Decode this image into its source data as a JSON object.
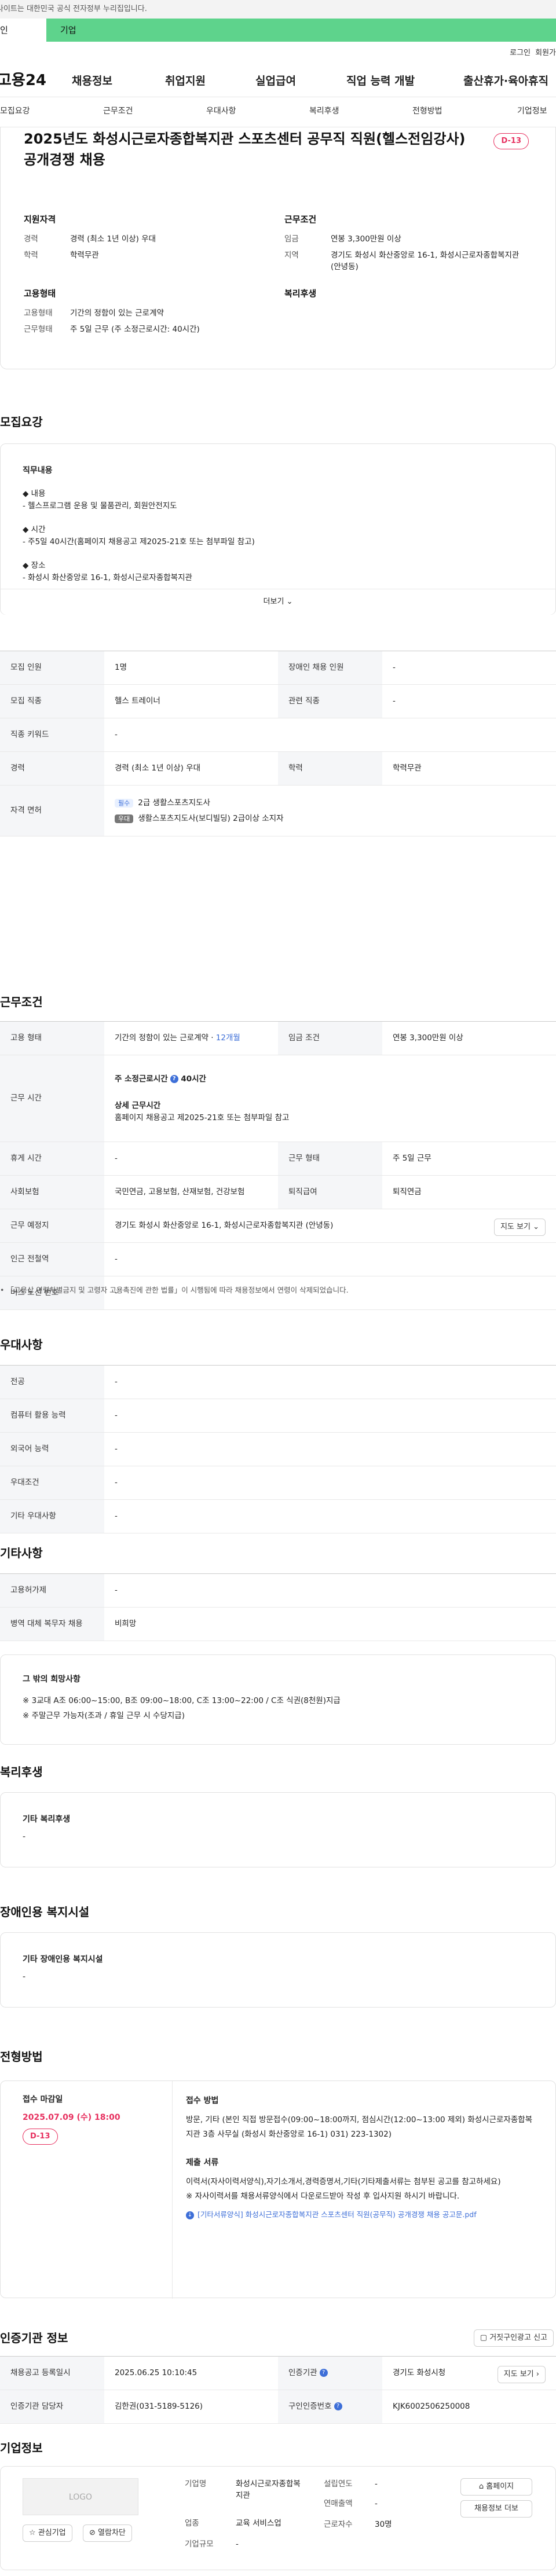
{
  "topbar": {
    "notice": "사이트는 대한민국 공식 전자정부 누리집입니다."
  },
  "usertabs": {
    "individual": "인",
    "enterprise": "기업"
  },
  "utility": {
    "login": "로그인",
    "join": "회원가"
  },
  "gnb": {
    "logo": "고용24",
    "menu": [
      "채용정보",
      "취업지원",
      "실업급여",
      "직업 능력 개발",
      "출산휴가·육아휴직"
    ]
  },
  "subnav": [
    "모집요강",
    "근무조건",
    "우대사항",
    "복리후생",
    "전형방법",
    "기업정보"
  ],
  "header": {
    "title": "2025년도 화성시근로자종합복지관 스포츠센터 공무직 직원(헬스전임강사) 공개경쟁 채용",
    "dday": "D-13"
  },
  "summary": {
    "qualification": {
      "title": "지원자격",
      "rows": [
        {
          "k": "경력",
          "v": "경력 (최소 1년 이상) 우대"
        },
        {
          "k": "학력",
          "v": "학력무관"
        }
      ]
    },
    "conditions": {
      "title": "근무조건",
      "rows": [
        {
          "k": "임금",
          "v": "연봉 3,300만원 이상"
        },
        {
          "k": "지역",
          "v": "경기도 화성시 화산중앙로 16-1, 화성시근로자종합복지관 (안녕동)"
        }
      ]
    },
    "employment": {
      "title": "고용형태",
      "rows": [
        {
          "k": "고용형태",
          "v": "기간의 정함이 있는 근로계약"
        },
        {
          "k": "근무형태",
          "v": "주 5일 근무 (주 소정근로시간: 40시간)"
        }
      ]
    },
    "welfare": {
      "title": "복리후생"
    }
  },
  "recruit": {
    "title": "모집요강",
    "duty_heading": "직무내용",
    "lines": [
      "◆ 내용",
      "- 헬스프로그램 운용 및 물품관리, 회원안전지도",
      "◆ 시간",
      "- 주5일 40시간(홈페이지 채용공고 제2025-21호 또는 첨부파일 참고)",
      "◆ 장소",
      "- 화성시 화산중앙로 16-1, 화성시근로자종합복지관"
    ],
    "more": "더보기",
    "table": {
      "headcount_label": "모집 인원",
      "headcount": "1명",
      "disabled_label": "장애인 채용 인원",
      "disabled": "-",
      "job_label": "모집 직종",
      "job": "헬스 트레이너",
      "related_label": "관련 직종",
      "related": "-",
      "keyword_label": "직종 키워드",
      "keyword": "-",
      "career_label": "경력",
      "career": "경력 (최소 1년 이상) 우대",
      "edu_label": "학력",
      "edu": "학력무관",
      "license_label": "자격 면허",
      "license_req_badge": "필수",
      "license_req": "2급 생활스포츠지도사",
      "license_opt_badge": "우대",
      "license_opt": "생활스포츠지도사(보디빌딩) 2급이상 소지자"
    }
  },
  "work": {
    "title": "근무조건",
    "type_label": "고용 형태",
    "type": "기간의 정함이 있는 근로계약 · ",
    "type_period": "12개월",
    "wage_label": "임금 조건",
    "wage": "연봉 3,300만원 이상",
    "hours_label": "근무 시간",
    "hours_weekly_label": "주 소정근로시간",
    "hours_weekly": "40시간",
    "hours_detail_label": "상세 근무시간",
    "hours_detail": "홈페이지 채용공고 제2025-21호 또는 첨부파일 참고",
    "rest_label": "휴게 시간",
    "rest": "-",
    "form_label": "근무 형태",
    "form": "주 5일 근무",
    "insurance_label": "사회보험",
    "insurance": "국민연금, 고용보험, 산재보험, 건강보험",
    "severance_label": "퇴직급여",
    "severance": "퇴직연금",
    "place_label": "근무 예정지",
    "place": "경기도 화성시 화산중앙로 16-1, 화성시근로자종합복지관 (안녕동)",
    "map_button": "지도 보기",
    "subway_label": "인근 전철역",
    "subway": "-",
    "bus_label": "버스 노선 번호",
    "bus": "-",
    "footnote": "「고용상 연령차별금지 및 고령자 고용촉진에 관한 법률」이 시행됨에 따라 채용정보에서 연령이 삭제되었습니다."
  },
  "preferred": {
    "title": "우대사항",
    "rows": [
      {
        "k": "전공",
        "v": "-"
      },
      {
        "k": "컴퓨터 활용 능력",
        "v": "-"
      },
      {
        "k": "외국어 능력",
        "v": "-"
      },
      {
        "k": "우대조건",
        "v": "-"
      },
      {
        "k": "기타 우대사항",
        "v": "-"
      }
    ]
  },
  "etc": {
    "title": "기타사항",
    "rows": [
      {
        "k": "고용허가제",
        "v": "-"
      },
      {
        "k": "병역 대체 복무자 채용",
        "v": "비희망"
      }
    ],
    "box_title": "그 밖의 희망사항",
    "box_lines": [
      "※ 3교대 A조 06:00~15:00, B조 09:00~18:00, C조 13:00~22:00 / C조 식권(8천원)지급",
      "※ 주말근무 가능자(조과 / 휴일 근무 시 수당지급)"
    ]
  },
  "welfare": {
    "title": "복리후생",
    "box_title": "기타 복리후생",
    "value": "-"
  },
  "disabled_facility": {
    "title": "장애인용 복지시설",
    "box_title": "기타 장애인용 복지시설",
    "value": "-"
  },
  "selection": {
    "title": "전형방법",
    "deadline_label": "접수 마감일",
    "deadline": "2025.07.09 (수) 18:00",
    "dday": "D-13",
    "method_label": "접수 방법",
    "method": "방문, 기타 (본인 직접 방문접수(09:00~18:00까지, 점심시간(12:00~13:00 제외) 화성시근로자종합복지관 3층 사무실 (화성시 화산중앙로 16-1) 031) 223-1302)",
    "docs_label": "제출 서류",
    "docs": "이력서(자사이력서양식),자기소개서,경력증명서,기타(기타제출서류는 첨부된 공고를 참고하세요)",
    "docs_note": "※ 자사이력서를 채용서류양식에서 다운로드받아 작성 후 입사지원 하시기 바랍니다.",
    "attachment": "[기타서류양식] 화성시근로자종합복지관 스포츠센터 직원(공무직) 공개경쟁 채용 공고문.pdf"
  },
  "recruiter": {
    "title": "인증기관 정보",
    "report_button": "거짓구인광고 신고",
    "reg_label": "채용공고 등록일시",
    "reg": "2025.06.25 10:10:45",
    "agency_label": "인증기관",
    "agency": "경기도 화성시청",
    "map_button": "지도 보기",
    "manager_label": "인증기관 담당자",
    "manager": "김한권(031-5189-5126)",
    "number_label": "구인인증번호",
    "number": "KJK6002506250008"
  },
  "company": {
    "title": "기업정보",
    "logo": "LOGO",
    "fav_button": "관심기업",
    "block_button": "열람차단",
    "name_label": "기업명",
    "name": "화성시근로자종합복지관",
    "founded_label": "설립연도",
    "founded": "-",
    "industry_label": "업종",
    "industry": "교육 서비스업",
    "sales_label": "연매출액",
    "sales": "-",
    "scale_label": "기업규모",
    "scale": "-",
    "employees_label": "근로자수",
    "employees": "30명",
    "homepage_button": "홈페이지",
    "jobs_button": "채용정보 더보"
  },
  "colors": {
    "accent_green": "#5ed38c",
    "dday_red": "#e7305f",
    "link_blue": "#3e6fd8"
  }
}
